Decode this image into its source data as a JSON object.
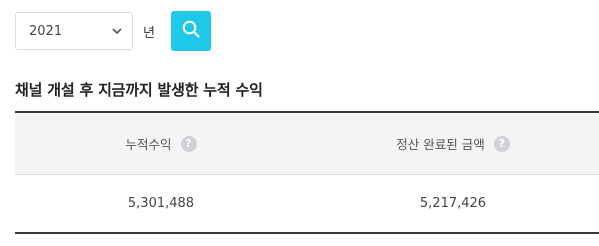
{
  "filter": {
    "year_value": "2021",
    "year_unit": "년"
  },
  "section": {
    "title": "채널 개설 후 지금까지 발생한 누적 수익"
  },
  "table": {
    "headers": [
      {
        "label": "누적수익",
        "help": "?"
      },
      {
        "label": "정산 완료된 금액",
        "help": "?"
      }
    ],
    "values": [
      "5,301,488",
      "5,217,426"
    ]
  },
  "icons": {
    "select": "chevron-down-icon",
    "search": "search-icon",
    "help": "help-icon"
  },
  "colors": {
    "accent": "#1ec8e8",
    "table_border": "#3a3a3a",
    "header_bg": "#f3f4f6"
  }
}
